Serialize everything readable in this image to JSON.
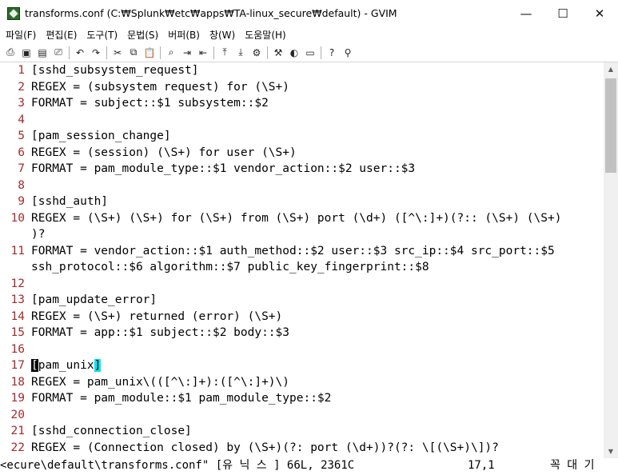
{
  "window": {
    "title": "transforms.conf (C:₩Splunk₩etc₩apps₩TA-linux_secure₩default) - GVIM",
    "minimize_glyph": "—",
    "maximize_glyph": "☐",
    "close_glyph": "✕"
  },
  "menu": [
    {
      "label": "파일(F)"
    },
    {
      "label": "편집(E)"
    },
    {
      "label": "도구(T)"
    },
    {
      "label": "문법(S)"
    },
    {
      "label": "버퍼(B)"
    },
    {
      "label": "창(W)"
    },
    {
      "label": "도움말(H)"
    }
  ],
  "toolbar": [
    {
      "name": "open-icon",
      "glyph": "⎙"
    },
    {
      "name": "save-icon",
      "glyph": "▣"
    },
    {
      "name": "save-all-icon",
      "glyph": "▤"
    },
    {
      "name": "print-icon",
      "glyph": "⎚"
    },
    {
      "sep": true
    },
    {
      "name": "undo-icon",
      "glyph": "↶"
    },
    {
      "name": "redo-icon",
      "glyph": "↷"
    },
    {
      "sep": true
    },
    {
      "name": "cut-icon",
      "glyph": "✂"
    },
    {
      "name": "copy-icon",
      "glyph": "⧉"
    },
    {
      "name": "paste-icon",
      "glyph": "📋"
    },
    {
      "sep": true
    },
    {
      "name": "find-replace-icon",
      "glyph": "⌕"
    },
    {
      "name": "find-next-icon",
      "glyph": "⇥"
    },
    {
      "name": "find-prev-icon",
      "glyph": "⇤"
    },
    {
      "sep": true
    },
    {
      "name": "load-session-icon",
      "glyph": "⤒"
    },
    {
      "name": "save-session-icon",
      "glyph": "⤓"
    },
    {
      "name": "run-script-icon",
      "glyph": "⚙"
    },
    {
      "sep": true
    },
    {
      "name": "make-icon",
      "glyph": "⚒"
    },
    {
      "name": "shell-icon",
      "glyph": "◐"
    },
    {
      "name": "ctags-icon",
      "glyph": "▭"
    },
    {
      "sep": true
    },
    {
      "name": "help-icon",
      "glyph": "?"
    },
    {
      "name": "find-help-icon",
      "glyph": "⚲"
    }
  ],
  "lines": [
    {
      "n": "1",
      "t": "[sshd_subsystem_request]"
    },
    {
      "n": "2",
      "t": "REGEX = (subsystem request) for (\\S+)"
    },
    {
      "n": "3",
      "t": "FORMAT = subject::$1 subsystem::$2"
    },
    {
      "n": "4",
      "t": ""
    },
    {
      "n": "5",
      "t": "[pam_session_change]"
    },
    {
      "n": "6",
      "t": "REGEX = (session) (\\S+) for user (\\S+)"
    },
    {
      "n": "7",
      "t": "FORMAT = pam_module_type::$1 vendor_action::$2 user::$3"
    },
    {
      "n": "8",
      "t": ""
    },
    {
      "n": "9",
      "t": "[sshd_auth]"
    },
    {
      "n": "10",
      "t": "REGEX = (\\S+) (\\S+) for (\\S+) from (\\S+) port (\\d+) ([^\\:]+)(?:: (\\S+) (\\S+)"
    },
    {
      "n": "",
      "t": ")?"
    },
    {
      "n": "11",
      "t": "FORMAT = vendor_action::$1 auth_method::$2 user::$3 src_ip::$4 src_port::$5"
    },
    {
      "n": "",
      "t": "ssh_protocol::$6 algorithm::$7 public_key_fingerprint::$8"
    },
    {
      "n": "12",
      "t": ""
    },
    {
      "n": "13",
      "t": "[pam_update_error]"
    },
    {
      "n": "14",
      "t": "REGEX = (\\S+) returned (error) (\\S+)"
    },
    {
      "n": "15",
      "t": "FORMAT = app::$1 subject::$2 body::$3"
    },
    {
      "n": "16",
      "t": ""
    },
    {
      "n": "17",
      "t": "",
      "cursor_char": "[",
      "mid": "pam_unix",
      "match_char": "]"
    },
    {
      "n": "18",
      "t": "REGEX = pam_unix\\(([^\\:]+):([^\\:]+)\\)"
    },
    {
      "n": "19",
      "t": "FORMAT = pam_module::$1 pam_module_type::$2"
    },
    {
      "n": "20",
      "t": ""
    },
    {
      "n": "21",
      "t": "[sshd_connection_close]"
    },
    {
      "n": "22",
      "t": "REGEX = (Connection closed) by (\\S+)(?: port (\\d+))?(?: \\[(\\S+)\\])?"
    }
  ],
  "status": {
    "file": "<ecure\\default\\transforms.conf\" [유 닉 스 ] 66L, 2361C",
    "position": "17,1",
    "scroll": "꼭 대 기"
  }
}
